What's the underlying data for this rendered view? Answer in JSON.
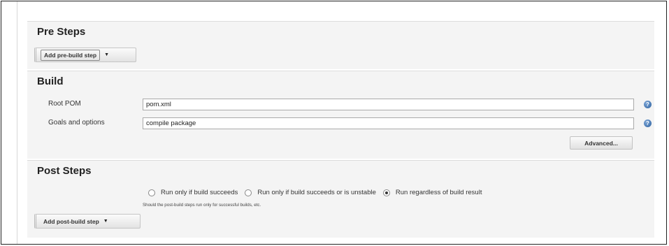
{
  "pre_steps": {
    "title": "Pre Steps",
    "add_button_label": "Add pre-build step",
    "add_button_caret": "▼"
  },
  "build": {
    "title": "Build",
    "root_pom": {
      "label": "Root POM",
      "value": "pom.xml"
    },
    "goals": {
      "label": "Goals and options",
      "value": "compile package"
    },
    "help_glyph": "?",
    "advanced_label": "Advanced..."
  },
  "post_steps": {
    "title": "Post Steps",
    "options": [
      {
        "label": "Run only if build succeeds",
        "checked": false
      },
      {
        "label": "Run only if build succeeds or is unstable",
        "checked": false
      },
      {
        "label": "Run regardless of build result",
        "checked": true
      }
    ],
    "hint": "Should the post-build steps run only for successful builds, etc.",
    "add_button_label": "Add post-build step",
    "add_button_caret": "▼"
  }
}
